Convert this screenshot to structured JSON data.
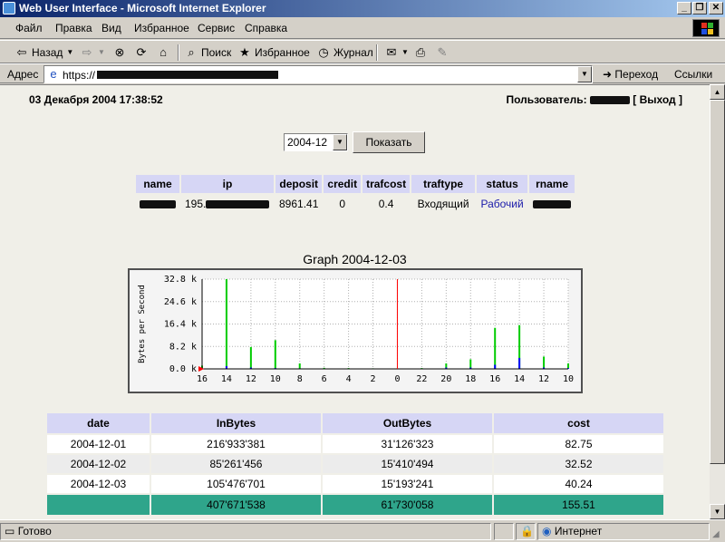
{
  "window": {
    "title": "Web User Interface - Microsoft Internet Explorer"
  },
  "menu": [
    "Файл",
    "Правка",
    "Вид",
    "Избранное",
    "Сервис",
    "Справка"
  ],
  "toolbar": {
    "back": "Назад",
    "search": "Поиск",
    "favorites": "Избранное",
    "history": "Журнал"
  },
  "address": {
    "label": "Адрес",
    "url": "https://",
    "go": "Переход",
    "links": "Ссылки"
  },
  "page": {
    "datetime": "03 Декабря 2004 17:38:52",
    "user_label": "Пользователь:",
    "logout": "[ Выход ]",
    "month_selected": "2004-12",
    "show_button": "Показать"
  },
  "user_table": {
    "headers": [
      "name",
      "ip",
      "deposit",
      "credit",
      "trafcost",
      "traftype",
      "status",
      "rname"
    ],
    "row": {
      "ip_prefix": "195.",
      "deposit": "8961.41",
      "credit": "0",
      "trafcost": "0.4",
      "traftype": "Входящий",
      "status": "Рабочий"
    }
  },
  "graph": {
    "title": "Graph 2004-12-03",
    "ylabel": "Bytes per Second",
    "yticks": [
      "32.8 k",
      "24.6 k",
      "16.4 k",
      "8.2 k",
      "0.0 k"
    ],
    "xticks": [
      "16",
      "14",
      "12",
      "10",
      "8",
      "6",
      "4",
      "2",
      "0",
      "22",
      "20",
      "18",
      "16",
      "14",
      "12",
      "10"
    ],
    "colors": {
      "in": "#00cc00",
      "out": "#0000ff",
      "now": "#ff0000"
    }
  },
  "chart_data": {
    "type": "area",
    "title": "Graph 2004-12-03",
    "ylabel": "Bytes per Second",
    "ylim": [
      0,
      32.8
    ],
    "y_unit": "k",
    "x": [
      "16",
      "14",
      "12",
      "10",
      "8",
      "6",
      "4",
      "2",
      "0",
      "22",
      "20",
      "18",
      "16",
      "14",
      "12",
      "10"
    ],
    "series": [
      {
        "values": [
          1.2,
          32.8,
          8.0,
          10.5,
          2.0,
          0.4,
          0.3,
          0.2,
          0.2,
          0.3,
          2.0,
          3.5,
          15.0,
          16.0,
          4.5,
          2.0
        ]
      },
      {
        "values": [
          0.3,
          1.0,
          0.5,
          0.3,
          0.2,
          0.1,
          0.1,
          0.1,
          0.1,
          0.1,
          0.5,
          0.5,
          1.5,
          4.0,
          0.5,
          0.3
        ]
      }
    ],
    "grid": true
  },
  "stats": {
    "headers": [
      "date",
      "InBytes",
      "OutBytes",
      "cost"
    ],
    "rows": [
      [
        "2004-12-01",
        "216'933'381",
        "31'126'323",
        "82.75"
      ],
      [
        "2004-12-02",
        "85'261'456",
        "15'410'494",
        "32.52"
      ],
      [
        "2004-12-03",
        "105'476'701",
        "15'193'241",
        "40.24"
      ]
    ],
    "total": [
      "",
      "407'671'538",
      "61'730'058",
      "155.51"
    ]
  },
  "status": {
    "text": "Готово",
    "zone": "Интернет"
  }
}
